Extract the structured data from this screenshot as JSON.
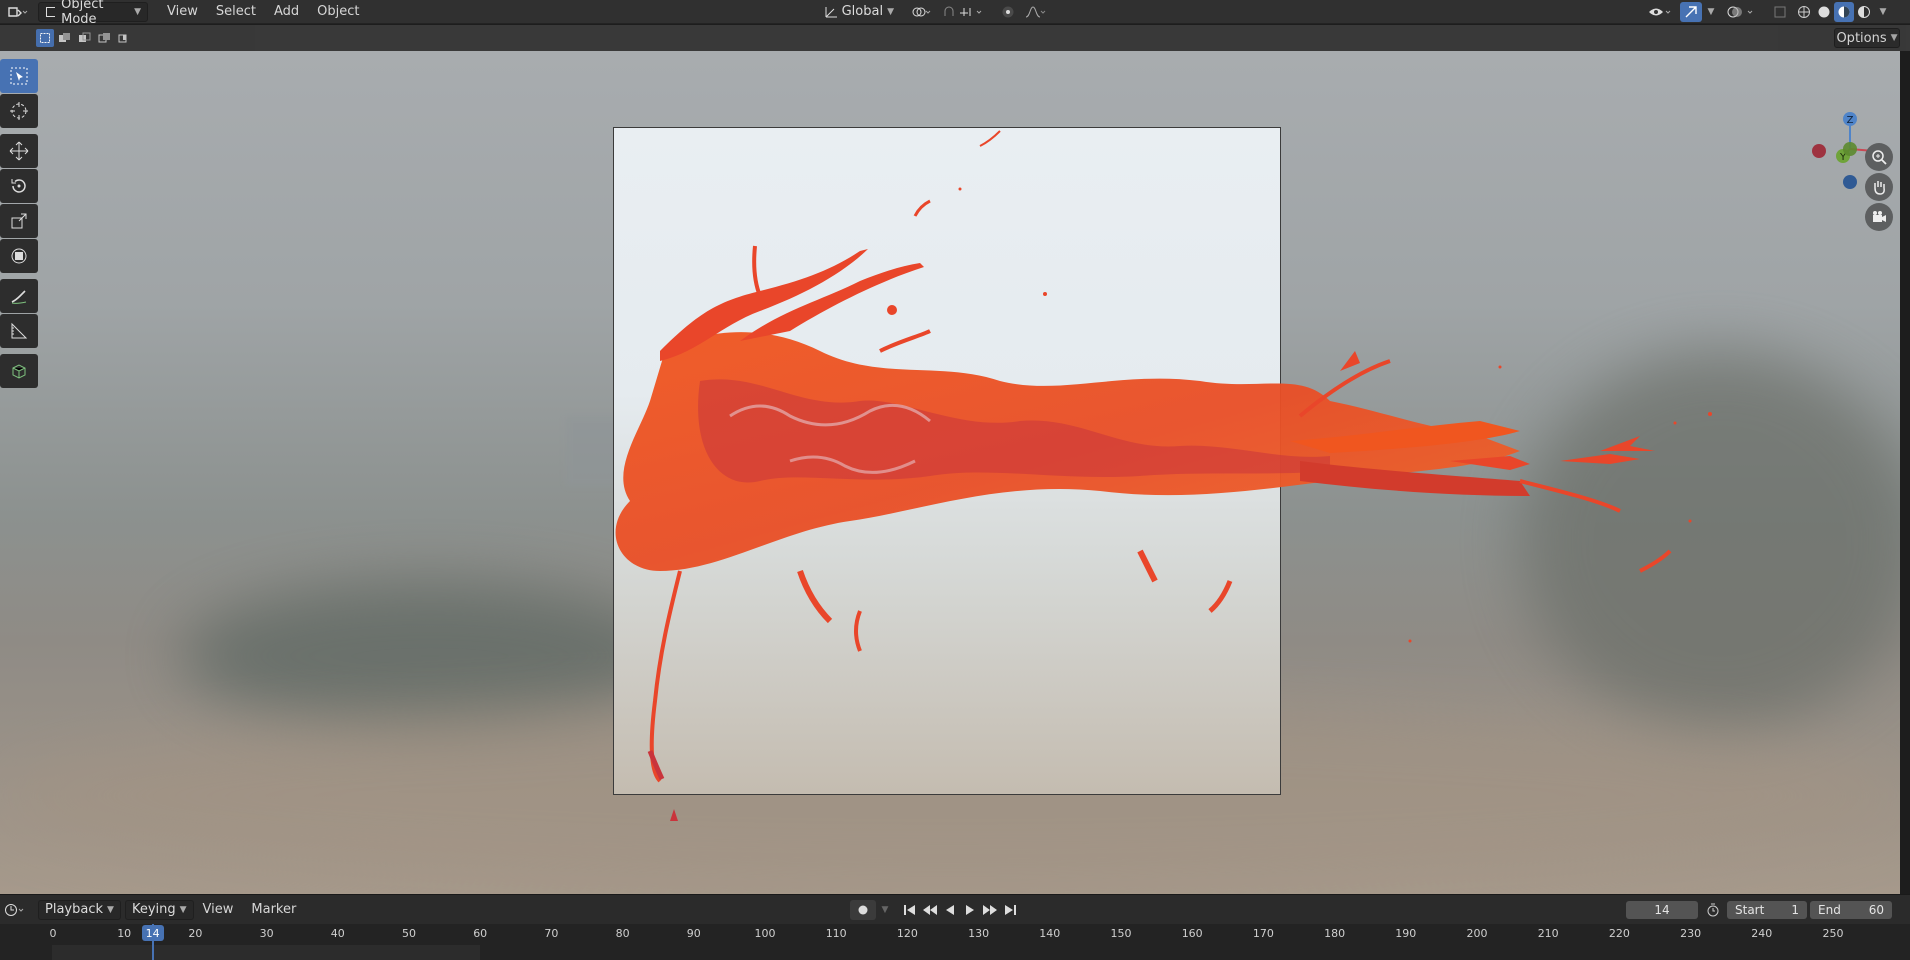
{
  "header": {
    "mode": "Object Mode",
    "menus": [
      "View",
      "Select",
      "Add",
      "Object"
    ],
    "orientation": "Global"
  },
  "tool_options": {
    "options_label": "Options"
  },
  "viewport": {
    "gizmo": {
      "z": "Z",
      "y": "Y",
      "x": "X"
    }
  },
  "timeline": {
    "menus": [
      "Playback",
      "Keying",
      "View",
      "Marker"
    ],
    "current_frame": "14",
    "start_label": "Start",
    "start_value": "1",
    "end_label": "End",
    "end_value": "60",
    "ticks": [
      "0",
      "10",
      "20",
      "30",
      "40",
      "50",
      "60",
      "70",
      "80",
      "90",
      "100",
      "110",
      "120",
      "130",
      "140",
      "150",
      "160",
      "170",
      "180",
      "190",
      "200",
      "210",
      "220",
      "230",
      "240",
      "250"
    ],
    "playhead": "14"
  },
  "colors": {
    "accent": "#4772b3",
    "splash": "#f0551e",
    "splash_dark": "#c8343a"
  }
}
